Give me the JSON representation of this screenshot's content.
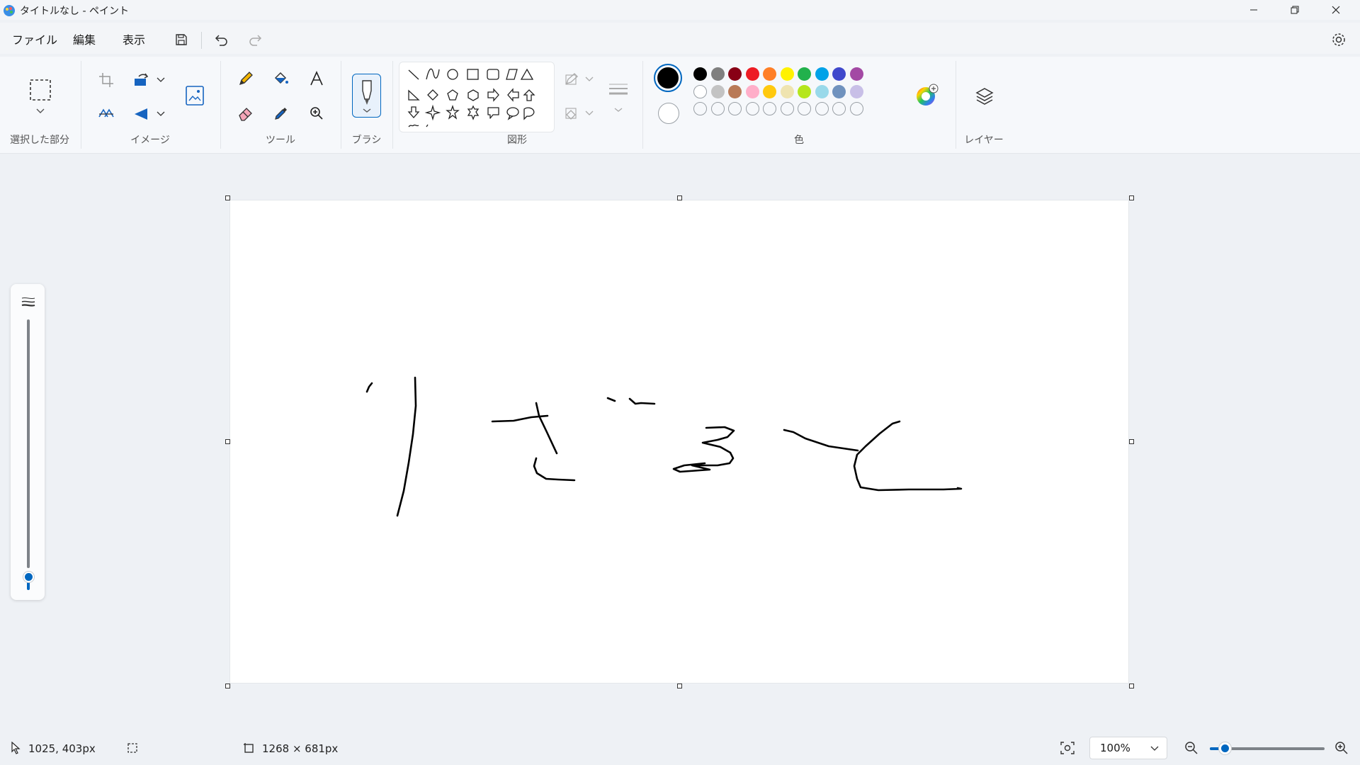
{
  "window": {
    "title": "タイトルなし - ペイント"
  },
  "menu": {
    "file": "ファイル",
    "edit": "編集",
    "view": "表示"
  },
  "ribbon": {
    "groups": {
      "selection": "選択した部分",
      "image": "イメージ",
      "tools": "ツール",
      "brushes": "ブラシ",
      "shapes": "図形",
      "colors": "色",
      "layers": "レイヤー"
    },
    "palette": {
      "row1": [
        "#000000",
        "#7f7f7f",
        "#880015",
        "#ed1c24",
        "#ff7f27",
        "#fff200",
        "#22b14c",
        "#00a2e8",
        "#3f48cc",
        "#a349a4"
      ],
      "row2": [
        "#ffffff",
        "#c3c3c3",
        "#b97a57",
        "#ffaec9",
        "#ffc90e",
        "#efe4b0",
        "#b5e61d",
        "#99d9ea",
        "#7092be",
        "#c8bfe7"
      ]
    },
    "primary_color": "#000000",
    "secondary_color": "#ffffff",
    "accent": "#0067c0"
  },
  "canvas": {
    "background": "#ffffff"
  },
  "statusbar": {
    "cursor_position": "1025, 403px",
    "canvas_size": "1268 × 681px",
    "zoom": "100%"
  }
}
